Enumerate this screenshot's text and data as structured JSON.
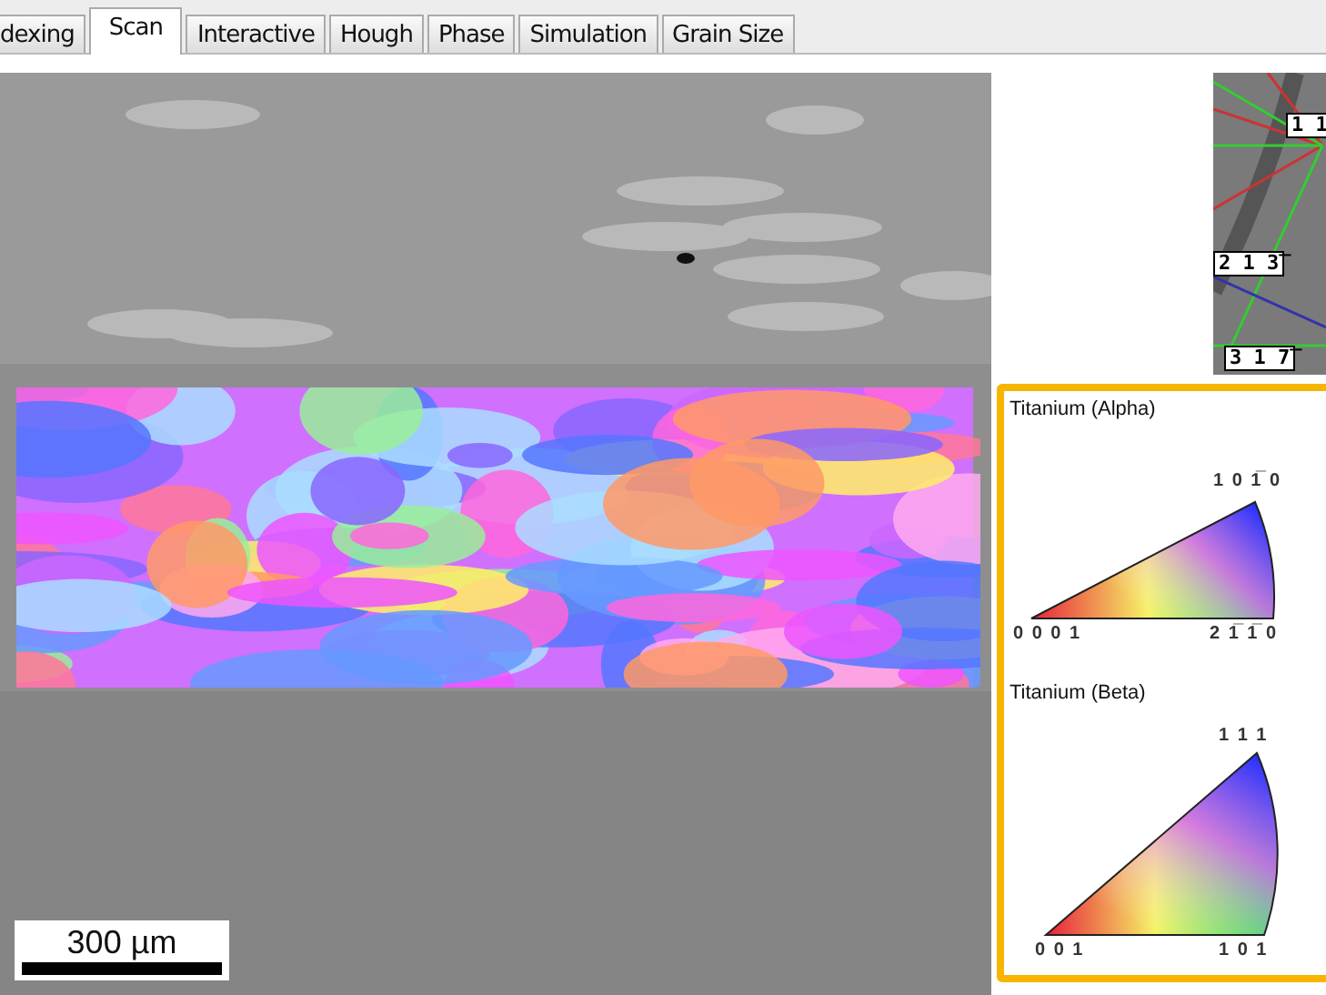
{
  "tabs": [
    {
      "label": "dexing",
      "selected": false
    },
    {
      "label": "Scan",
      "selected": true
    },
    {
      "label": "Interactive",
      "selected": false
    },
    {
      "label": "Hough",
      "selected": false
    },
    {
      "label": "Phase",
      "selected": false
    },
    {
      "label": "Simulation",
      "selected": false
    },
    {
      "label": "Grain Size",
      "selected": false
    }
  ],
  "micrograph": {
    "scale_bar": "300 µm"
  },
  "pattern": {
    "labels": [
      "1 1",
      "2 1 3̅",
      "3 1 7̅"
    ]
  },
  "legend": {
    "phases": [
      {
        "name": "Titanium (Alpha)",
        "kind": "hexagonal",
        "corners": [
          "1 0 1̅ 0",
          "0 0 0 1",
          "2 1̅ 1̅ 0"
        ]
      },
      {
        "name": "Titanium (Beta)",
        "kind": "cubic",
        "corners": [
          "1 1 1",
          "0 0 1",
          "1 0 1"
        ]
      }
    ]
  }
}
